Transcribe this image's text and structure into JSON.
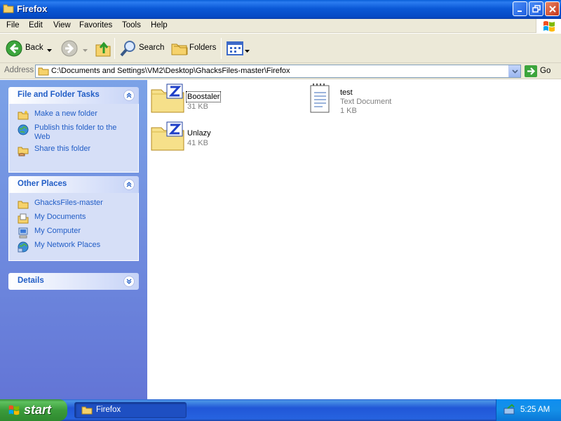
{
  "window": {
    "title": "Firefox"
  },
  "menu": [
    "File",
    "Edit",
    "View",
    "Favorites",
    "Tools",
    "Help"
  ],
  "toolbar": {
    "back_label": "Back",
    "search_label": "Search",
    "folders_label": "Folders"
  },
  "address": {
    "label": "Address",
    "path": "C:\\Documents and Settings\\VM2\\Desktop\\GhacksFiles-master\\Firefox",
    "go_label": "Go"
  },
  "panels": {
    "tasks": {
      "title": "File and Folder Tasks",
      "items": [
        "Make a new folder",
        "Publish this folder to the Web",
        "Share this folder"
      ]
    },
    "places": {
      "title": "Other Places",
      "items": [
        "GhacksFiles-master",
        "My Documents",
        "My Computer",
        "My Network Places"
      ]
    },
    "details": {
      "title": "Details"
    }
  },
  "files": [
    {
      "name": "Boostaler",
      "size": "31 KB",
      "type": ""
    },
    {
      "name": "test",
      "type": "Text Document",
      "size": "1 KB"
    },
    {
      "name": "Unlazy",
      "size": "41 KB",
      "type": ""
    }
  ],
  "taskbar": {
    "start_label": "start",
    "task_label": "Firefox",
    "clock": "5:25 AM"
  },
  "colors": {
    "title_bar": "#0a58d6",
    "left_pane": "#6f8de0",
    "link": "#215dc6",
    "taskbar": "#2157d7",
    "start": "#3b9b3b"
  }
}
